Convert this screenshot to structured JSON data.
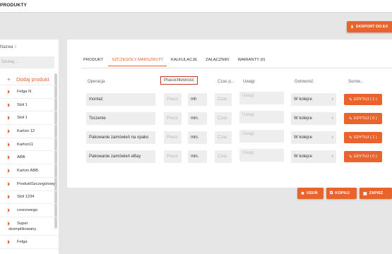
{
  "app": {
    "title": "PRODUKTY"
  },
  "toolbar": {
    "export_label": "EKSPORT DO EX",
    "export_icon": "download-icon"
  },
  "sidebar": {
    "header": "Nazwa",
    "sort_glyph": "⇳",
    "search_placeholder": "Szukaj ...",
    "add_label": "Dodaj produkt",
    "items": [
      {
        "label": "Felga N"
      },
      {
        "label": "Stół 1"
      },
      {
        "label": "Stół 1"
      },
      {
        "label": "Karton 12"
      },
      {
        "label": "Karton11"
      },
      {
        "label": "ABB"
      },
      {
        "label": "Karton ABB"
      },
      {
        "label": "ProduktSzczegolowy"
      },
      {
        "label": "Stół 1234"
      },
      {
        "label": "cosnowego"
      },
      {
        "label": "Super",
        "label2": "skomplikowany"
      },
      {
        "label": "Felga"
      }
    ]
  },
  "tabs": [
    {
      "label": "PRODUKT",
      "active": false
    },
    {
      "label": "SZCZEGÓŁY MARSZRUTY",
      "active": true
    },
    {
      "label": "KALKULACJE",
      "active": false
    },
    {
      "label": "ZAŁĄCZNIKI",
      "active": false
    },
    {
      "label": "WARIANTY (0)",
      "active": false
    }
  ],
  "table": {
    "headers": {
      "operacja": "Operacja",
      "pracochlonnosc": "Pracochłonność",
      "czas": "Czas p...",
      "uwagi": "Uwagi",
      "gotowosc": "Gotowość",
      "surowce": "Surow..."
    },
    "rows": [
      {
        "operacja": "montaż",
        "praco_placeholder": "Praco",
        "unit": "mh",
        "czas_placeholder": "Czas",
        "uwagi_placeholder": "Uwagi",
        "gotowosc": "W kolejce",
        "edit_label": "EDYTUJ ( 1 )"
      },
      {
        "operacja": "Toczenie",
        "praco_placeholder": "Praco",
        "unit": "min.",
        "czas_placeholder": "Czas",
        "uwagi_placeholder": "Uwagi",
        "gotowosc": "W kolejce",
        "edit_label": "EDYTUJ ( 0 )"
      },
      {
        "operacja": "Pakowanie zamówień na opako",
        "praco_placeholder": "Praco",
        "unit": "min.",
        "czas_placeholder": "Czas",
        "uwagi_placeholder": "Uwagi",
        "gotowosc": "W kolejce",
        "edit_label": "EDYTUJ ( 1 )"
      },
      {
        "operacja": "Pakowanie zamówień eBay",
        "praco_placeholder": "Praco",
        "unit": "min.",
        "czas_placeholder": "Czas",
        "uwagi_placeholder": "Uwagi",
        "gotowosc": "W kolejce",
        "edit_label": "EDYTUJ ( 0 )"
      }
    ]
  },
  "actions": {
    "delete_label": "USUŃ",
    "copy_label": "KOPIUJ",
    "save_label": "ZAPISZ"
  },
  "colors": {
    "accent": "#e8642c",
    "highlight_box": "#c0392b"
  }
}
